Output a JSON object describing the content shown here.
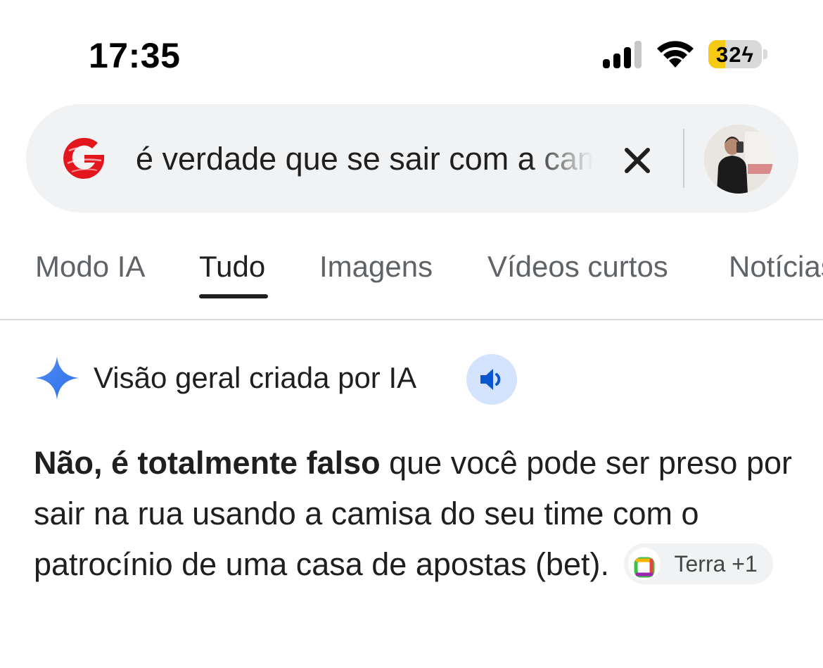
{
  "status_bar": {
    "time": "17:35",
    "battery_level": "32",
    "battery_charging": true,
    "battery_fraction": 0.32,
    "signal_bars_active": 3,
    "signal_bars_total": 4
  },
  "search": {
    "query": "é verdade que se sair com a camisa",
    "logo_icon": "google-g-icon",
    "clear_icon": "close-icon"
  },
  "tabs": [
    {
      "label": "Modo IA",
      "active": false
    },
    {
      "label": "Tudo",
      "active": true
    },
    {
      "label": "Imagens",
      "active": false
    },
    {
      "label": "Vídeos curtos",
      "active": false
    },
    {
      "label": "Notícias",
      "active": false
    }
  ],
  "ai_overview": {
    "title": "Visão geral criada por IA",
    "icon": "sparkle-icon",
    "listen_icon": "speaker-icon",
    "answer_bold": "Não, é totalmente falso",
    "answer_rest": " que você pode ser preso por sair na rua usando a camisa do seu time com o patrocínio de uma casa de apostas (bet).",
    "source_chip": "Terra +1"
  },
  "colors": {
    "accent_blue": "#4285f4",
    "google_red": "#e3161d",
    "battery_yellow": "#f6c915",
    "search_bg": "#f0f2f4",
    "speaker_bg": "#d3e3fd"
  }
}
